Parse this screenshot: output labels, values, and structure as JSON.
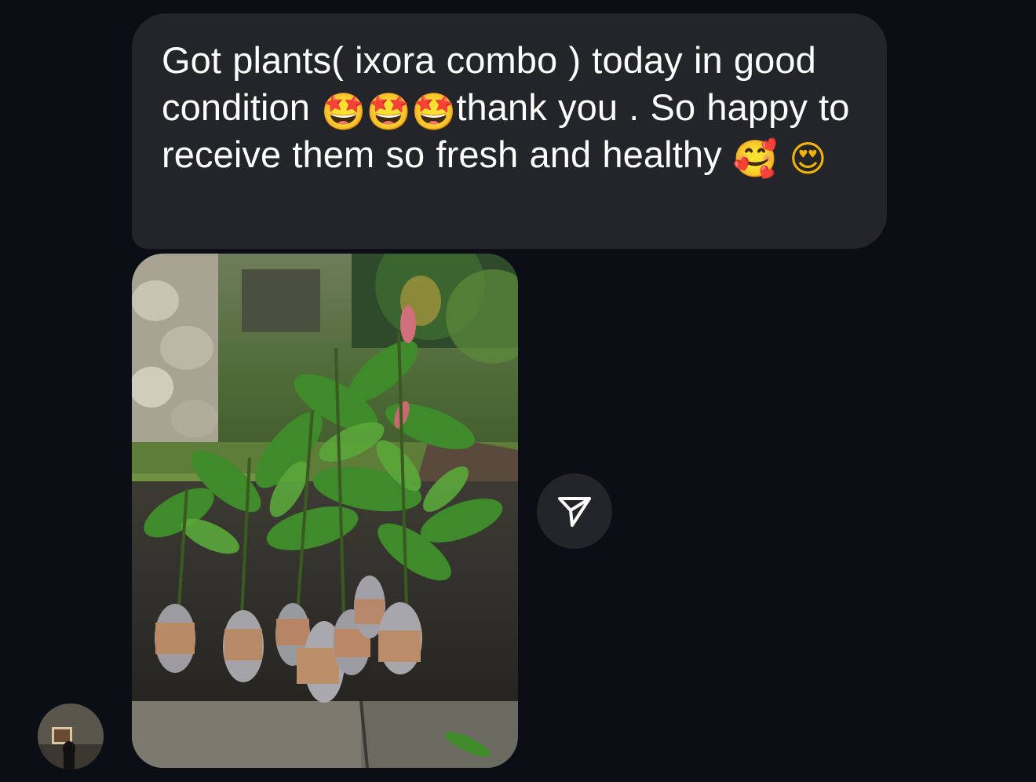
{
  "message": {
    "segments": [
      {
        "kind": "text",
        "value": "Got plants( ixora combo ) today in good condition "
      },
      {
        "kind": "emoji",
        "value": "🤩"
      },
      {
        "kind": "emoji",
        "value": "🤩"
      },
      {
        "kind": "emoji",
        "value": "🤩"
      },
      {
        "kind": "text",
        "value": "thank you . So happy to receive them so fresh and healthy "
      },
      {
        "kind": "emoji",
        "value": "🥰"
      },
      {
        "kind": "text",
        "value": " "
      },
      {
        "kind": "emoji",
        "value": "😍"
      }
    ]
  },
  "photo": {
    "subject": "ixora plant saplings in wrapped pots"
  },
  "share": {
    "icon": "paper-plane-icon"
  },
  "avatar": {
    "icon": "profile-avatar"
  },
  "colors": {
    "background": "#0b0e14",
    "bubble": "#232529",
    "text": "#ffffff"
  }
}
